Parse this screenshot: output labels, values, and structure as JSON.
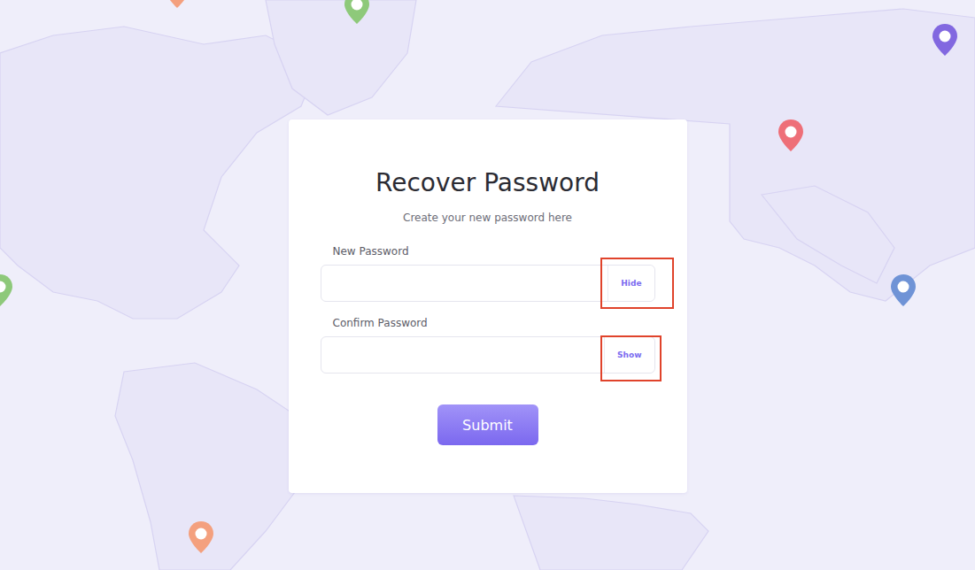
{
  "page": {
    "title": "Recover Password",
    "subtitle": "Create your new password here"
  },
  "fields": [
    {
      "label": "New Password",
      "value": "",
      "visible": true,
      "toggle": "Hide",
      "highlighted": true
    },
    {
      "label": "Confirm Password",
      "value": "",
      "visible": false,
      "toggle": "Show",
      "highlighted": true
    }
  ],
  "submit": {
    "label": "Submit"
  },
  "map_pins": [
    {
      "color": "#8ec97a"
    },
    {
      "color": "#f4a07e"
    },
    {
      "color": "#8268e0"
    },
    {
      "color": "#ee6f78"
    },
    {
      "color": "#6f93d6"
    },
    {
      "color": "#8ec97a"
    },
    {
      "color": "#f4a07e"
    }
  ]
}
